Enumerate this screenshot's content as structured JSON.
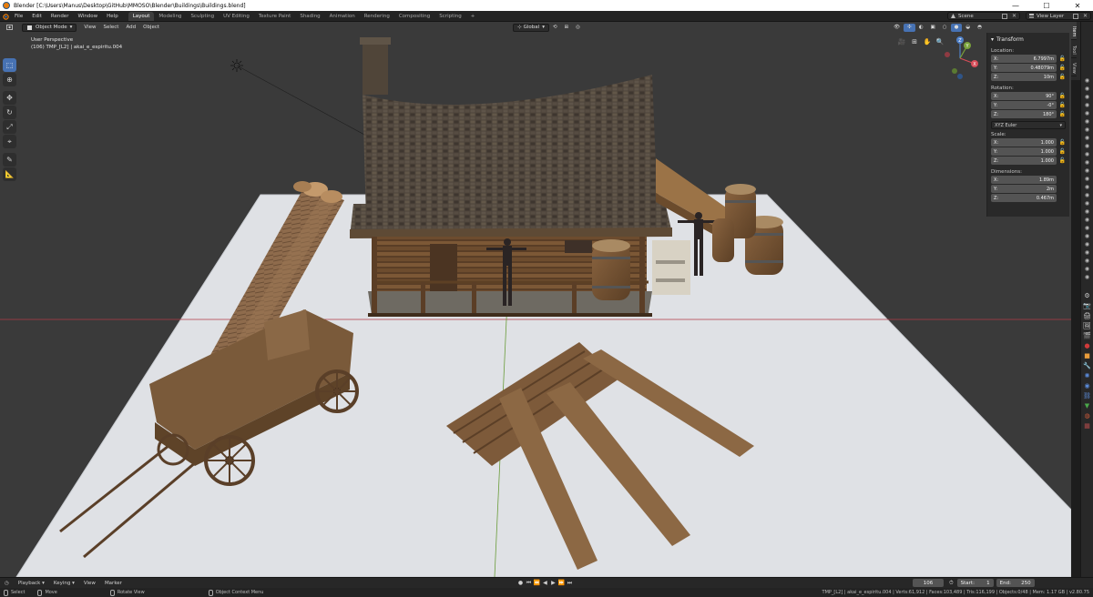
{
  "window": {
    "title": "Blender [C:\\Users\\Manus\\Desktop\\GitHub\\MMOSO\\Blender\\Buildings\\Buildings.blend]",
    "controls": [
      "—",
      "☐",
      "✕"
    ]
  },
  "menu": [
    "File",
    "Edit",
    "Render",
    "Window",
    "Help"
  ],
  "workspaces": [
    "Layout",
    "Modeling",
    "Sculpting",
    "UV Editing",
    "Texture Paint",
    "Shading",
    "Animation",
    "Rendering",
    "Compositing",
    "Scripting",
    "+"
  ],
  "active_workspace": "Layout",
  "scene": {
    "label": "Scene"
  },
  "view_layer": {
    "label": "View Layer"
  },
  "viewport_header": {
    "mode": "Object Mode",
    "menus": [
      "View",
      "Select",
      "Add",
      "Object"
    ],
    "transform_orientation": "Global"
  },
  "viewport_info": {
    "line1": "User Perspective",
    "line2": "(106) TMP_[L2] | akai_e_espiritu.004"
  },
  "gizmo": {
    "x": "X",
    "y": "Y",
    "z": "Z"
  },
  "npanel": {
    "title": "Transform",
    "location_label": "Location:",
    "location": [
      {
        "axis": "X:",
        "value": "6.7997m"
      },
      {
        "axis": "Y:",
        "value": "0.48079m"
      },
      {
        "axis": "Z:",
        "value": "10m"
      }
    ],
    "rotation_label": "Rotation:",
    "rotation": [
      {
        "axis": "X:",
        "value": "90°"
      },
      {
        "axis": "Y:",
        "value": "-0°"
      },
      {
        "axis": "Z:",
        "value": "180°"
      }
    ],
    "rotation_mode": "XYZ Euler",
    "scale_label": "Scale:",
    "scale": [
      {
        "axis": "X:",
        "value": "1.000"
      },
      {
        "axis": "Y:",
        "value": "1.000"
      },
      {
        "axis": "Z:",
        "value": "1.000"
      }
    ],
    "dimensions_label": "Dimensions:",
    "dimensions": [
      {
        "axis": "X:",
        "value": "1.89m"
      },
      {
        "axis": "Y:",
        "value": "2m"
      },
      {
        "axis": "Z:",
        "value": "0.467m"
      }
    ],
    "tabs": [
      "Item",
      "Tool",
      "View"
    ]
  },
  "timeline": {
    "menus": [
      "Playback",
      "Keying",
      "View",
      "Marker"
    ],
    "current_frame": "106",
    "start_label": "Start:",
    "start": "1",
    "end_label": "End:",
    "end": "250"
  },
  "statusbar": {
    "select": "Select",
    "move": "Move",
    "rotate": "Rotate View",
    "context": "Object Context Menu",
    "stats": "TMP_[L2] | akai_e_espiritu.004 | Verts:61,912 | Faces:103,489 | Tris:116,199 | Objects:0/48 | Mem: 1.17 GB | v2.80.75"
  }
}
